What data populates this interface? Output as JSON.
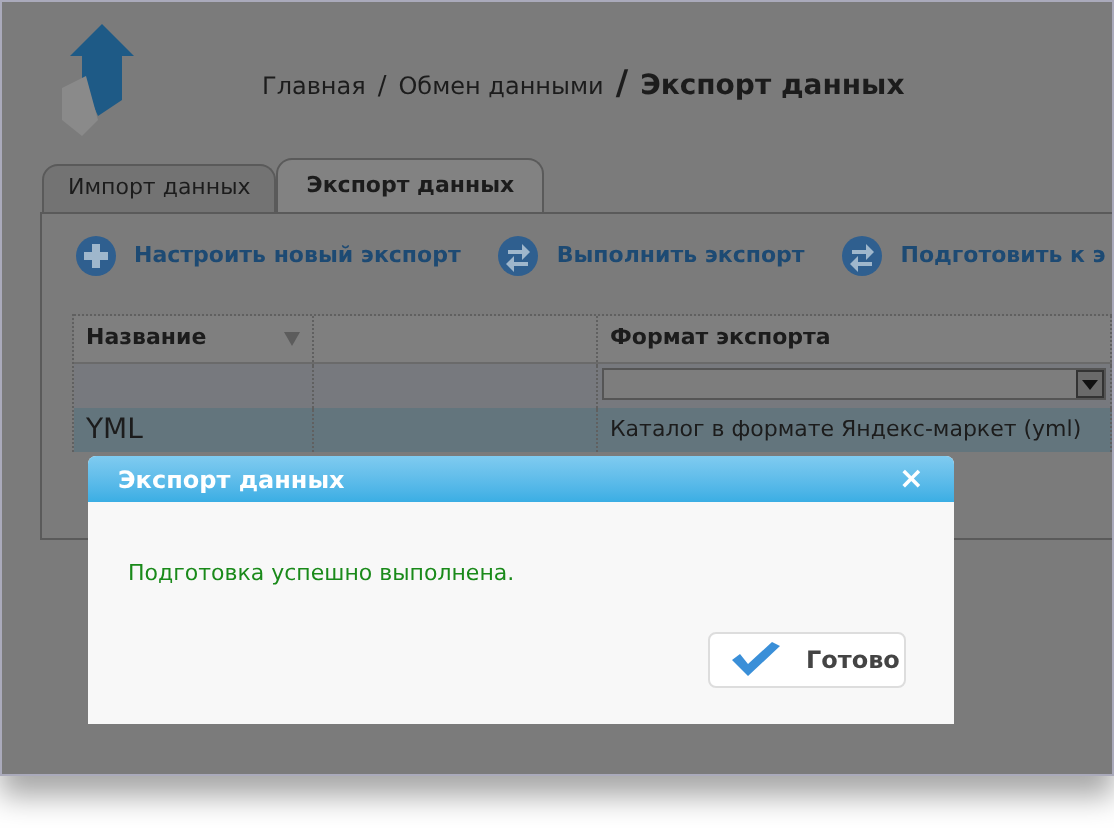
{
  "breadcrumb": {
    "items": [
      "Главная",
      "Обмен данными"
    ],
    "separator": "/",
    "current": "Экспорт данных"
  },
  "tabs": [
    {
      "label": "Импорт данных",
      "selected": false
    },
    {
      "label": "Экспорт данных",
      "selected": true
    }
  ],
  "toolbar": [
    {
      "kind": "add",
      "label": "Настроить новый экспорт"
    },
    {
      "kind": "run",
      "label": "Выполнить экспорт"
    },
    {
      "kind": "run",
      "label": "Подготовить к э"
    }
  ],
  "table": {
    "columns": [
      {
        "header": "Название",
        "sortable": true
      },
      {},
      {
        "header": "Формат экспорта"
      }
    ],
    "rows": [
      {
        "selected": true,
        "cells": [
          "YML",
          "",
          "Каталог в формате Яндекс-маркет (yml)"
        ]
      }
    ]
  },
  "dialog": {
    "title": "Экспорт данных",
    "close": "×",
    "message": "Подготовка успешно выполнена.",
    "button": "Готово"
  }
}
